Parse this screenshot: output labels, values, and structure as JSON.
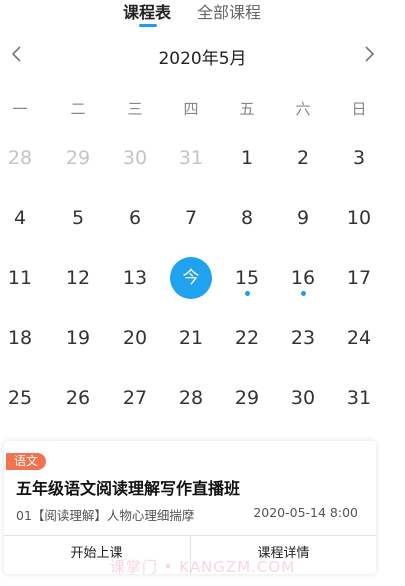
{
  "tabs": {
    "schedule_label": "课程表",
    "all_courses_label": "全部课程",
    "accent_color": "#1f9cf0"
  },
  "calendar": {
    "month_title": "2020年5月",
    "prev_icon": "chevron-left-icon",
    "next_icon": "chevron-right-icon",
    "weekdays": [
      "一",
      "二",
      "三",
      "四",
      "五",
      "六",
      "日"
    ],
    "weeks": [
      [
        {
          "d": "28",
          "other": true
        },
        {
          "d": "29",
          "other": true
        },
        {
          "d": "30",
          "other": true
        },
        {
          "d": "31",
          "other": true
        },
        {
          "d": "1"
        },
        {
          "d": "2"
        },
        {
          "d": "3"
        }
      ],
      [
        {
          "d": "4"
        },
        {
          "d": "5"
        },
        {
          "d": "6"
        },
        {
          "d": "7"
        },
        {
          "d": "8"
        },
        {
          "d": "9"
        },
        {
          "d": "10"
        }
      ],
      [
        {
          "d": "11"
        },
        {
          "d": "12"
        },
        {
          "d": "13"
        },
        {
          "d": "今",
          "today": true
        },
        {
          "d": "15",
          "dot": true
        },
        {
          "d": "16",
          "dot": true
        },
        {
          "d": "17"
        }
      ],
      [
        {
          "d": "18"
        },
        {
          "d": "19"
        },
        {
          "d": "20"
        },
        {
          "d": "21"
        },
        {
          "d": "22"
        },
        {
          "d": "23"
        },
        {
          "d": "24"
        }
      ],
      [
        {
          "d": "25"
        },
        {
          "d": "26"
        },
        {
          "d": "27"
        },
        {
          "d": "28"
        },
        {
          "d": "29"
        },
        {
          "d": "30"
        },
        {
          "d": "31"
        }
      ]
    ],
    "today_color": "#1fa3f1"
  },
  "course_card": {
    "subject_badge": "语文",
    "badge_color": "#f2734d",
    "title": "五年级语文阅读理解写作直播班",
    "lesson": "01【阅读理解】人物心理细揣摩",
    "time": "2020-05-14 8:00",
    "start_button": "开始上课",
    "detail_button": "课程详情"
  },
  "watermark": "课掌门 • KANGZM.COM"
}
